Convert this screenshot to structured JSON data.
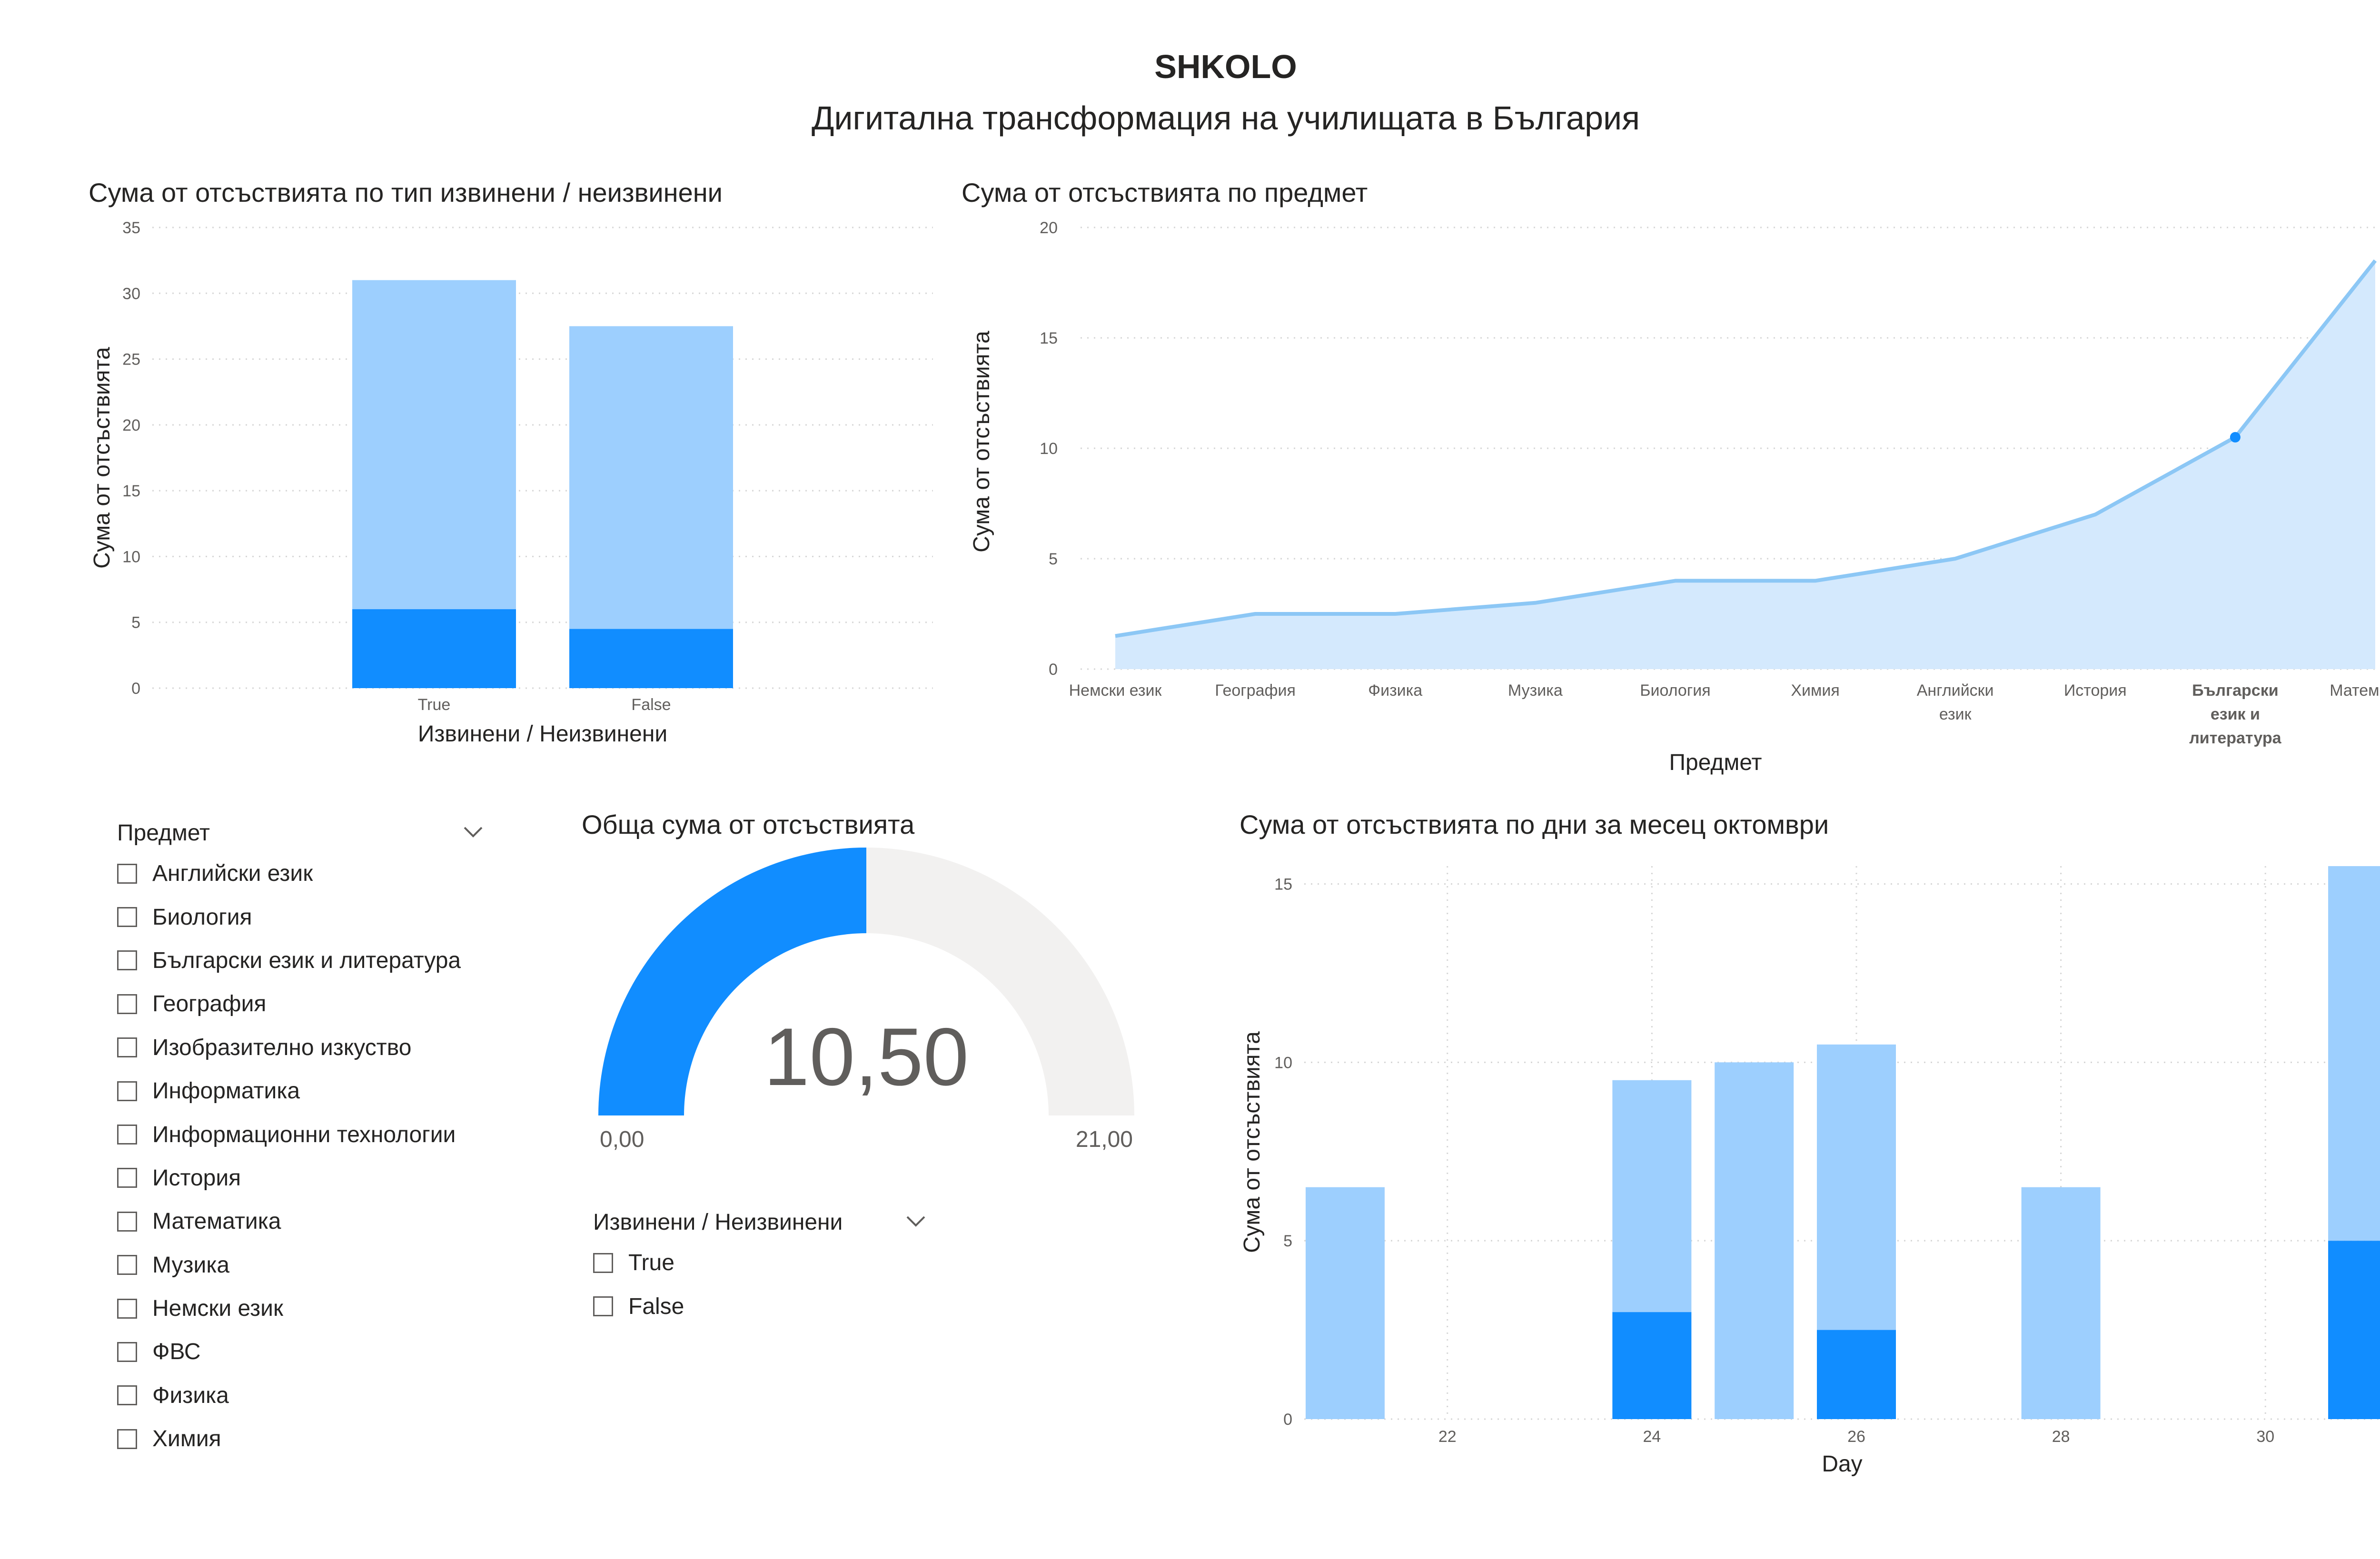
{
  "header": {
    "title": "SHKOLO",
    "subtitle": "Дигитална трансформация на училищата в България"
  },
  "colors": {
    "light": "#9dcffe",
    "dark": "#118dff",
    "line": "#8cc7f5",
    "area": "#d4e9fd",
    "gauge_empty": "#f2f1f0",
    "grid": "#d6d6d6"
  },
  "chart_data": [
    {
      "type": "bar",
      "title": "Сума от отсъствията по тип извинени / неизвинени",
      "xlabel": "Извинени / Неизвинени",
      "ylabel": "Сума от отсъствията",
      "categories": [
        "True",
        "False"
      ],
      "series": [
        {
          "values": [
            6,
            4.5
          ],
          "color": "#118dff"
        },
        {
          "values": [
            25,
            23
          ],
          "color": "#9dcffe"
        }
      ],
      "stacked": true,
      "ylim": [
        0,
        35
      ],
      "yticks": [
        0,
        5,
        10,
        15,
        20,
        25,
        30,
        35
      ],
      "grid": true
    },
    {
      "type": "area",
      "title": "Сума от отсъствията по предмет",
      "xlabel": "Предмет",
      "ylabel": "Сума от отсъствията",
      "categories": [
        "Немски език",
        "География",
        "Физика",
        "Музика",
        "Биология",
        "Химия",
        "Английски език",
        "История",
        "Български език и литература",
        "Математика"
      ],
      "values": [
        1.5,
        2.5,
        2.5,
        3,
        4,
        4,
        5,
        7,
        10.5,
        18.5
      ],
      "highlight_index": 8,
      "ylim": [
        0,
        20
      ],
      "yticks": [
        0,
        5,
        10,
        15,
        20
      ],
      "grid": true
    },
    {
      "type": "bar",
      "title": "Сума от отсъствията по дни за месец октомври",
      "xlabel": "Day",
      "ylabel": "Сума от отсъствията",
      "x": [
        21,
        24,
        25,
        26,
        28,
        31
      ],
      "series": [
        {
          "values": [
            0,
            3,
            0,
            2.5,
            0,
            5
          ],
          "color": "#118dff"
        },
        {
          "values": [
            6.5,
            6.5,
            10,
            8,
            6.5,
            10.5
          ],
          "color": "#9dcffe"
        }
      ],
      "stacked": true,
      "xlim": [
        20.6,
        31.4
      ],
      "xticks": [
        22,
        24,
        26,
        28,
        30
      ],
      "ylim": [
        0,
        15.5
      ],
      "yticks": [
        0,
        5,
        10,
        15
      ],
      "grid": true
    }
  ],
  "gauge": {
    "title": "Обща сума от отсъствията",
    "value": 10.5,
    "min": 0,
    "max": 21,
    "value_label": "10,50",
    "min_label": "0,00",
    "max_label": "21,00"
  },
  "slicer_subject": {
    "header": "Предмет",
    "chevron_icon": "chevron-down-icon",
    "items": [
      "Английски език",
      "Биология",
      "Български език и литература",
      "География",
      "Изобразително изкуство",
      "Информатика",
      "Информационни технологии",
      "История",
      "Математика",
      "Музика",
      "Немски език",
      "ФВС",
      "Физика",
      "Химия"
    ]
  },
  "slicer_excused": {
    "header": "Извинени / Неизвинени",
    "chevron_icon": "chevron-down-icon",
    "items": [
      "True",
      "False"
    ]
  }
}
